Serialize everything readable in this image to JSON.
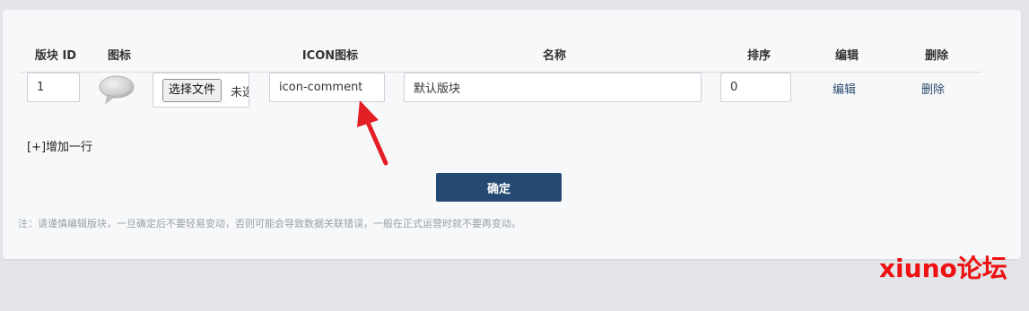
{
  "table": {
    "headers": {
      "id": "版块 ID",
      "icon": "图标",
      "icon_class": "ICON图标",
      "name": "名称",
      "order": "排序",
      "edit": "编辑",
      "delete": "删除"
    },
    "rows": [
      {
        "id": "1",
        "file_button": "选择文件",
        "file_status": "未选",
        "icon_class": "icon-comment",
        "name": "默认版块",
        "order": "0",
        "edit": "编辑",
        "delete": "删除"
      }
    ]
  },
  "add_row": "[+]增加一行",
  "submit": "确定",
  "note": "注：请谨慎编辑版块，一旦确定后不要轻易变动，否则可能会导致数据关联错误，一般在正式运营时就不要再变动。",
  "watermark": "xiuno论坛",
  "colors": {
    "primary_button": "#244a73",
    "link": "#2c4a6e",
    "annotation_arrow": "#e31e24",
    "watermark": "#ee1111"
  }
}
